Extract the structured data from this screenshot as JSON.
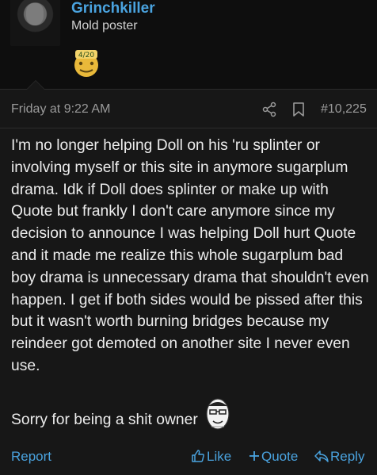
{
  "user": {
    "name": "Grinchkiller",
    "title": "Mold poster",
    "badge_text": "4/20"
  },
  "post": {
    "date": "Friday at 9:22 AM",
    "number": "#10,225",
    "body": "I'm no longer helping Doll on his 'ru splinter or involving myself or this site in anymore sugarplum drama. Idk if Doll does splinter or make up with Quote but frankly I don't care anymore since my decision to announce I was helping Doll hurt Quote and it made me realize this whole sugarplum bad boy drama is unnecessary drama that shouldn't even happen. I get if both sides would be pissed after this but it wasn't worth burning bridges because my reindeer got demoted on another site I never even use.",
    "signoff": "Sorry for being a shit owner"
  },
  "actions": {
    "report": "Report",
    "like": "Like",
    "quote": "Quote",
    "reply": "Reply"
  },
  "icons": {
    "share": "share-icon",
    "bookmark": "bookmark-icon",
    "like": "thumbs-up-icon",
    "quote": "plus-icon",
    "reply": "reply-arrow-icon"
  },
  "colors": {
    "accent": "#4aa3df",
    "background": "#171717",
    "header_background": "#0e0e0e",
    "muted_text": "#9a9a9a"
  }
}
